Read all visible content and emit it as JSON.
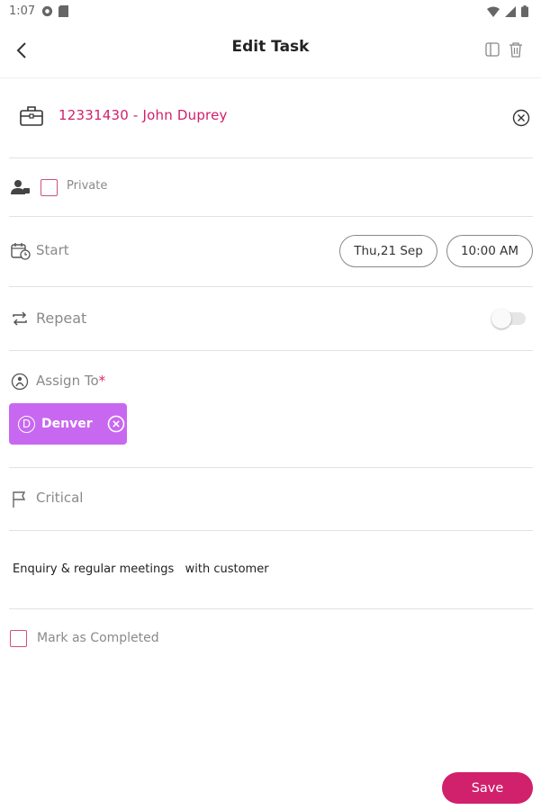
{
  "status_bar": {
    "time": "1:07"
  },
  "appbar": {
    "title": "Edit Task"
  },
  "customer": {
    "text": "12331430  - John Duprey"
  },
  "private": {
    "label": "Private",
    "checked": false
  },
  "start": {
    "label": "Start",
    "date": "Thu,21 Sep",
    "time": "10:00 AM"
  },
  "repeat": {
    "label": "Repeat",
    "enabled": false
  },
  "assign": {
    "label": "Assign To",
    "required_mark": "*",
    "assignee": {
      "initial": "D",
      "name": "Denver"
    }
  },
  "priority": {
    "label": "Critical"
  },
  "description": {
    "text": "Enquiry & regular meetings   with customer"
  },
  "completed": {
    "label": "Mark as Completed",
    "checked": false
  },
  "save": {
    "label": "Save"
  },
  "colors": {
    "accent": "#d1206c",
    "chip": "#c868f0",
    "muted": "#8a8a8a"
  }
}
